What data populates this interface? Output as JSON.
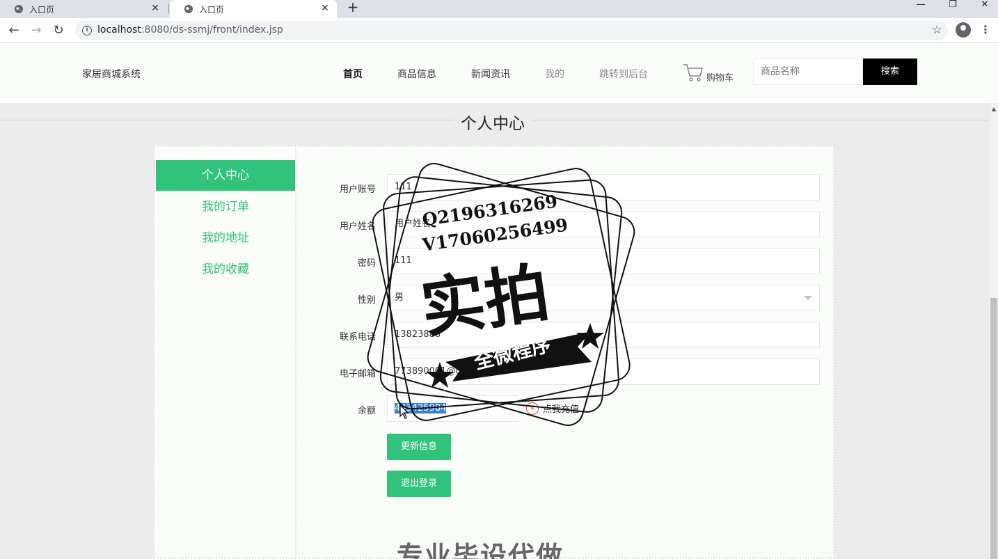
{
  "browser": {
    "tabs": [
      {
        "title": "入口页"
      },
      {
        "title": "入口页"
      }
    ],
    "new_tab": "+",
    "url_host": "localhost",
    "url_rest": ":8080/ds-ssmj/front/index.jsp",
    "window_buttons": [
      "—",
      "❐",
      "✕"
    ]
  },
  "header": {
    "brand": "家居商城系统",
    "nav": [
      "首页",
      "商品信息",
      "新闻资讯",
      "我的",
      "跳转到后台"
    ],
    "cart_label": "购物车",
    "search_placeholder": "商品名称",
    "search_button": "搜索"
  },
  "page": {
    "title": "个人中心"
  },
  "sidebar": {
    "items": [
      {
        "label": "个人中心",
        "active": true
      },
      {
        "label": "我的订单",
        "active": false
      },
      {
        "label": "我的地址",
        "active": false
      },
      {
        "label": "我的收藏",
        "active": false
      }
    ]
  },
  "form": {
    "fields": [
      {
        "label": "用户账号",
        "value": "111"
      },
      {
        "label": "用户姓名",
        "value": "用户姓名"
      },
      {
        "label": "密码",
        "value": "111"
      },
      {
        "label": "性别",
        "value": "男"
      },
      {
        "label": "联系电话",
        "value": "13823888"
      },
      {
        "label": "电子邮箱",
        "value": "773890001@qq"
      }
    ],
    "balance_label": "余额",
    "balance_value": "443425984",
    "recharge_label": "点我充值",
    "update_button": "更新信息",
    "logout_button": "退出登录"
  },
  "watermark": {
    "line1": "Q2196316269",
    "line2": "V17060256499",
    "big": "实拍",
    "ribbon": "全微程序",
    "bottom": "专业毕设代做"
  }
}
